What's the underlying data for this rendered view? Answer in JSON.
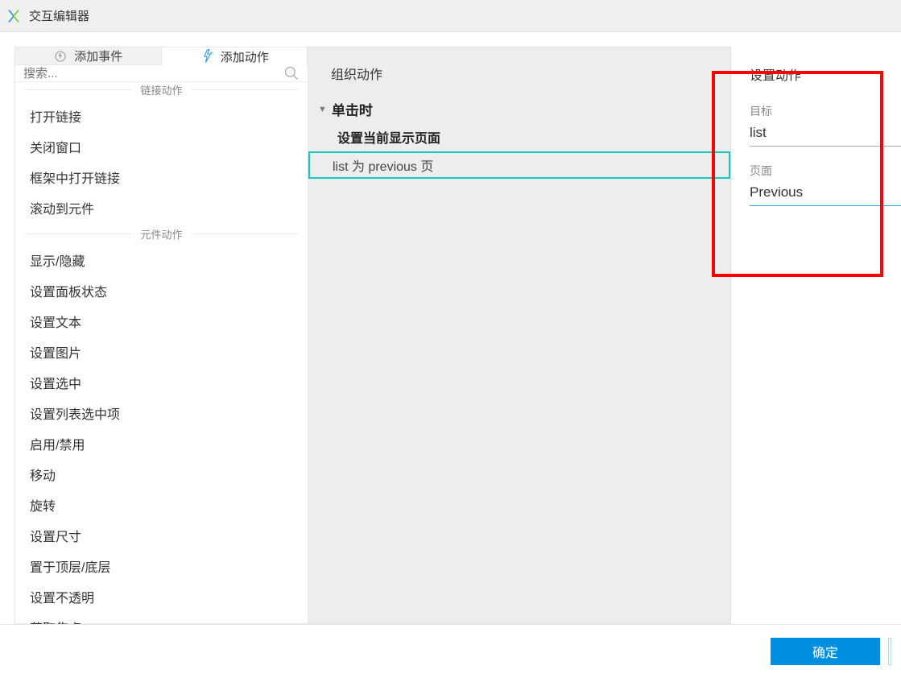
{
  "window": {
    "title": "交互编辑器"
  },
  "left": {
    "tabs": {
      "add_event": "添加事件",
      "add_action": "添加动作"
    },
    "search_placeholder": "搜索...",
    "groups": {
      "link_actions": {
        "title": "链接动作",
        "items": [
          "打开链接",
          "关闭窗口",
          "框架中打开链接",
          "滚动到元件"
        ]
      },
      "widget_actions": {
        "title": "元件动作",
        "items": [
          "显示/隐藏",
          "设置面板状态",
          "设置文本",
          "设置图片",
          "设置选中",
          "设置列表选中项",
          "启用/禁用",
          "移动",
          "旋转",
          "设置尺寸",
          "置于顶层/底层",
          "设置不透明",
          "获取焦点"
        ]
      }
    }
  },
  "mid": {
    "title": "组织动作",
    "event": "单击时",
    "case_label": "设置当前显示页面",
    "action_row": "list 为 previous 页"
  },
  "right": {
    "title": "设置动作",
    "target_label": "目标",
    "target_value": "list",
    "page_label": "页面",
    "page_value": "Previous"
  },
  "footer": {
    "ok": "确定"
  }
}
